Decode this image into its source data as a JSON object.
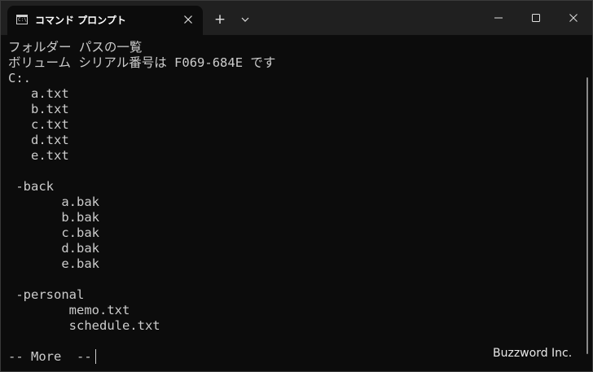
{
  "window": {
    "tab_title": "コマンド プロンプト",
    "tab_icon_label": "C:\\",
    "tab_icon": "terminal-icon",
    "close_tab_icon": "close-icon",
    "new_tab_label": "+",
    "dropdown_icon": "chevron-down-icon",
    "minimize_icon": "minimize-icon",
    "maximize_icon": "maximize-icon",
    "close_icon": "close-icon"
  },
  "terminal": {
    "lines": [
      "フォルダー パスの一覧",
      "ボリューム シリアル番号は F069-684E です",
      "C:.",
      "   a.txt",
      "   b.txt",
      "   c.txt",
      "   d.txt",
      "   e.txt",
      "",
      " -back",
      "       a.bak",
      "       b.bak",
      "       c.bak",
      "       d.bak",
      "       e.bak",
      "",
      " -personal",
      "        memo.txt",
      "        schedule.txt",
      "",
      "-- More  -- "
    ]
  },
  "watermark": "Buzzword Inc.",
  "colors": {
    "background": "#0c0c0c",
    "titlebar": "#202020",
    "text": "#cccccc"
  }
}
